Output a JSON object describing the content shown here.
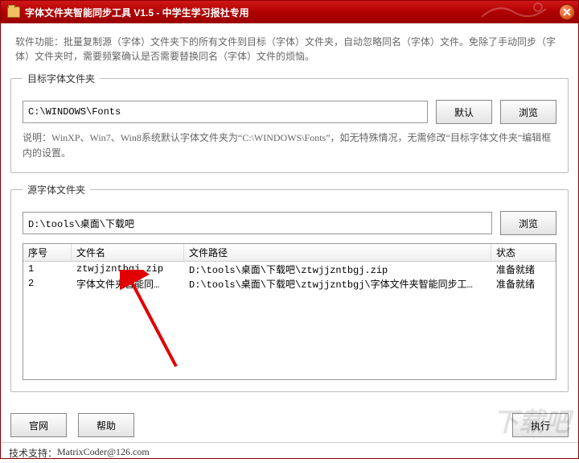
{
  "title": "字体文件夹智能同步工具 V1.5 - 中学生学习报社专用",
  "description": "软件功能：批量复制源（字体）文件夹下的所有文件到目标（字体）文件夹，自动忽略同名（字体）文件。免除了手动同步（字体）文件夹时，需要频繁确认是否需要替换同名（字体）文件的烦恼。",
  "target_group": {
    "legend": "目标字体文件夹",
    "path": "C:\\WINDOWS\\Fonts",
    "default_label": "默认",
    "browse_label": "浏览",
    "hint_prefix": "说明：WinXP、Win7、Win8系统默认字体文件夹为",
    "hint_quoted": "“C:\\WINDOWS\\Fonts”",
    "hint_suffix": "，如无特殊情况，无需修改“目标字体文件夹”编辑框内的设置。"
  },
  "source_group": {
    "legend": "源字体文件夹",
    "path": "D:\\tools\\桌面\\下载吧",
    "browse_label": "浏览",
    "columns": {
      "idx": "序号",
      "name": "文件名",
      "path": "文件路径",
      "status": "状态"
    },
    "rows": [
      {
        "idx": "1",
        "name": "ztwjjzntbgj.zip",
        "path": "D:\\tools\\桌面\\下载吧\\ztwjjzntbgj.zip",
        "status": "准备就绪"
      },
      {
        "idx": "2",
        "name": "字体文件夹智能同…",
        "path": "D:\\tools\\桌面\\下载吧\\ztwjjzntbgj\\字体文件夹智能同步工…",
        "status": "准备就绪"
      }
    ]
  },
  "buttons": {
    "website": "官网",
    "help": "帮助",
    "execute": "执行"
  },
  "footer": {
    "support_label": "技术支持：",
    "support_contact": "MatrixCoder@126.com"
  },
  "watermark": "下载吧"
}
